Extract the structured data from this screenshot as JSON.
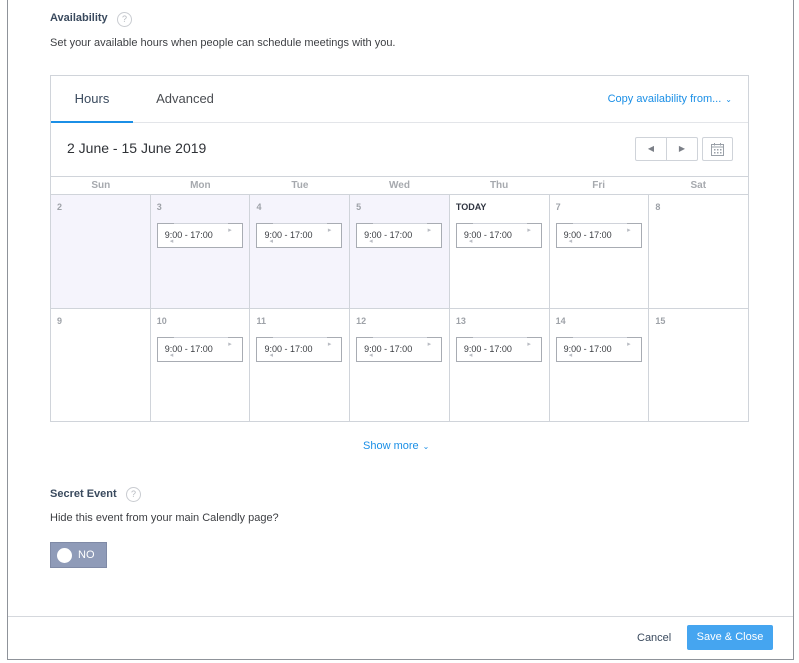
{
  "availability": {
    "title": "Availability",
    "help": "?",
    "description": "Set your available hours when people can schedule meetings with you.",
    "tabs": [
      {
        "label": "Hours",
        "active": true
      },
      {
        "label": "Advanced",
        "active": false
      }
    ],
    "copy_label": "Copy availability from...",
    "date_range": "2 June - 15 June 2019",
    "weekdays": [
      "Sun",
      "Mon",
      "Tue",
      "Wed",
      "Thu",
      "Fri",
      "Sat"
    ],
    "weeks": [
      [
        {
          "num": "2",
          "past": true,
          "slot": null
        },
        {
          "num": "3",
          "past": true,
          "slot": "9:00 - 17:00"
        },
        {
          "num": "4",
          "past": true,
          "slot": "9:00 - 17:00"
        },
        {
          "num": "5",
          "past": true,
          "slot": "9:00 - 17:00"
        },
        {
          "num": "TODAY",
          "past": false,
          "today": true,
          "slot": "9:00 - 17:00"
        },
        {
          "num": "7",
          "past": false,
          "slot": "9:00 - 17:00"
        },
        {
          "num": "8",
          "past": false,
          "slot": null
        }
      ],
      [
        {
          "num": "9",
          "past": false,
          "slot": null
        },
        {
          "num": "10",
          "past": false,
          "slot": "9:00 - 17:00"
        },
        {
          "num": "11",
          "past": false,
          "slot": "9:00 - 17:00"
        },
        {
          "num": "12",
          "past": false,
          "slot": "9:00 - 17:00"
        },
        {
          "num": "13",
          "past": false,
          "slot": "9:00 - 17:00"
        },
        {
          "num": "14",
          "past": false,
          "slot": "9:00 - 17:00"
        },
        {
          "num": "15",
          "past": false,
          "slot": null
        }
      ]
    ],
    "show_more": "Show more"
  },
  "secret_event": {
    "title": "Secret Event",
    "help": "?",
    "description": "Hide this event from your main Calendly page?",
    "toggle_label": "NO"
  },
  "footer": {
    "cancel": "Cancel",
    "save": "Save & Close"
  },
  "colors": {
    "accent": "#1b8fe6",
    "save_button": "#45a5f0",
    "toggle_off": "#8f9bb8",
    "past_day_bg": "#f5f4fc"
  }
}
